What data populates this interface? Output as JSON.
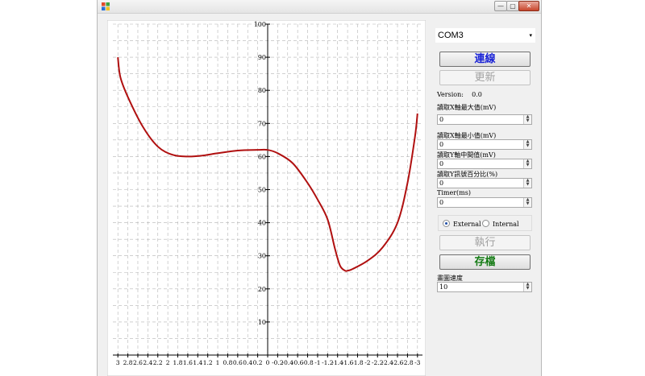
{
  "window": {
    "icons": {
      "app": "app-icon",
      "minimize": "minimize-icon",
      "maximize": "maximize-icon",
      "close": "close-icon"
    },
    "minimize_glyph": "—",
    "maximize_glyph": "▢",
    "close_glyph": "✕"
  },
  "chart_data": {
    "type": "line",
    "title": "",
    "xlabel": "",
    "ylabel": "",
    "y_ticks": [
      "100",
      "90",
      "80",
      "70",
      "60",
      "50",
      "40",
      "30",
      "20",
      "10"
    ],
    "x_ticks": [
      "3",
      "2.8",
      "2.6",
      "2.4",
      "2.2",
      "2",
      "1.8",
      "1.6",
      "1.4",
      "1.2",
      "1",
      "0.8",
      "0.6",
      "0.4",
      "0.2",
      "0",
      "-0.2",
      "-0.4",
      "-0.6",
      "-0.8",
      "-1",
      "-1.2",
      "-1.4",
      "-1.6",
      "-1.8",
      "-2",
      "-2.2",
      "-2.4",
      "-2.6",
      "-2.8",
      "-3"
    ],
    "xlim": [
      3.1,
      -3.1
    ],
    "ylim": [
      0,
      100
    ],
    "grid": true,
    "color": "#b01010",
    "series": [
      {
        "x": [
          3.0,
          2.95,
          2.8,
          2.5,
          2.2,
          1.9,
          1.6,
          1.3,
          1.0,
          0.6,
          0.2,
          0.0,
          -0.2,
          -0.5,
          -0.8,
          -1.0,
          -1.2,
          -1.35,
          -1.45,
          -1.55,
          -1.6,
          -1.7,
          -2.0,
          -2.3,
          -2.6,
          -2.8,
          -2.95,
          -3.0
        ],
        "y": [
          90,
          84,
          78,
          69,
          63,
          60.5,
          60,
          60.3,
          61,
          61.8,
          62,
          62,
          61,
          58,
          52,
          47,
          41,
          32,
          27,
          25.5,
          25.5,
          26,
          28.5,
          32.5,
          40,
          52,
          66,
          73
        ]
      }
    ]
  },
  "panel": {
    "port": {
      "value": "COM3",
      "arrow": "▾"
    },
    "connect_label": "連線",
    "update_label": "更新",
    "version_label": "Version:",
    "version_value": "0.0",
    "xmax_label": "讀取X軸最大值(mV)",
    "xmax_value": "0",
    "xmin_label": "讀取X軸最小值(mV)",
    "xmin_value": "0",
    "ymid_label": "讀取Y軸中間值(mV)",
    "ymid_value": "0",
    "ypct_label": "讀取Y訊號百分比(%)",
    "ypct_value": "0",
    "timer_label": "Timer(ms)",
    "timer_value": "0",
    "external_label": "External",
    "internal_label": "Internal",
    "execute_label": "執行",
    "save_label": "存檔",
    "speed_label": "畫圖速度",
    "speed_value": "10",
    "spin_up": "▲",
    "spin_down": "▼"
  }
}
